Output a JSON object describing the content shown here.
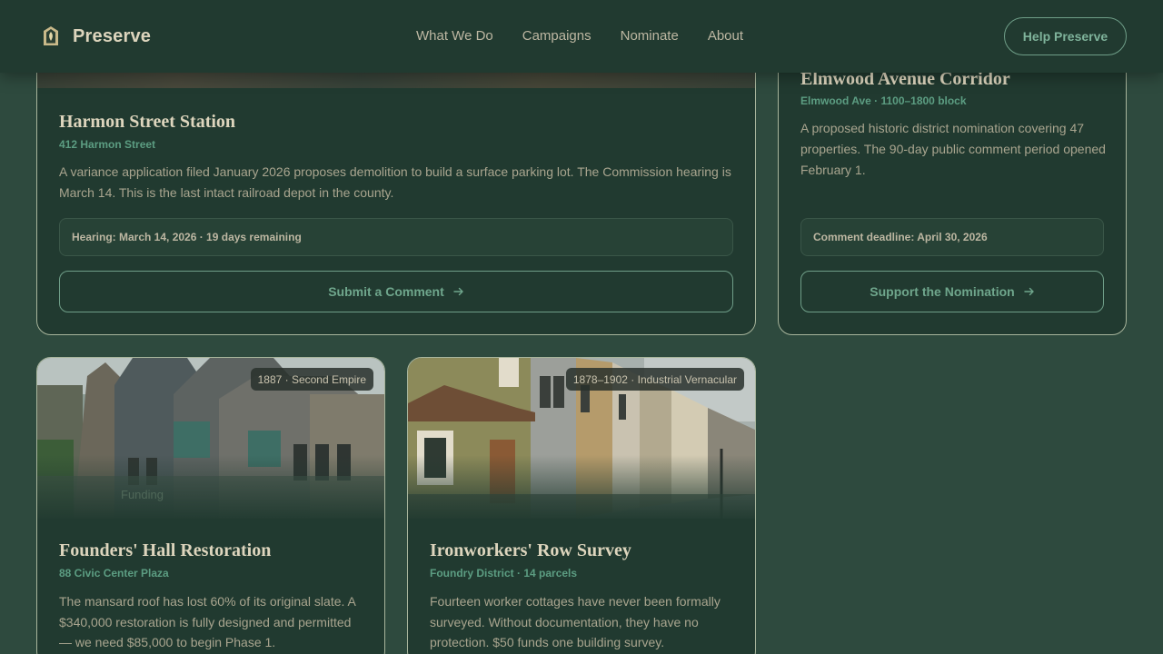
{
  "header": {
    "brand": "Preserve",
    "nav": [
      "What We Do",
      "Campaigns",
      "Nominate",
      "About"
    ],
    "cta_label": "Help Preserve"
  },
  "cards": {
    "harmon": {
      "title": "Harmon Street Station",
      "subtitle": "412 Harmon Street",
      "description": "A variance application filed January 2026 proposes demolition to build a surface parking lot. The Commission hearing is March 14. This is the last intact railroad depot in the county.",
      "info": "Hearing: March 14, 2026 · 19 days remaining",
      "button_label": "Submit a Comment"
    },
    "elmwood": {
      "title": "Elmwood Avenue Corridor",
      "subtitle": "Elmwood Ave · 1100–1800 block",
      "description": "A proposed historic district nomination covering 47 properties. The 90-day public comment period opened February 1.",
      "info": "Comment deadline: April 30, 2026",
      "button_label": "Support the Nomination"
    },
    "founders": {
      "badge": "1887 · Second Empire",
      "image_caption": "Funding",
      "title": "Founders' Hall Restoration",
      "subtitle": "88 Civic Center Plaza",
      "description": "The mansard roof has lost 60% of its original slate. A $340,000 restoration is fully designed and permitted — we need $85,000 to begin Phase 1."
    },
    "ironworkers": {
      "badge": "1878–1902 · Industrial Vernacular",
      "title": "Ironworkers' Row Survey",
      "subtitle": "Foundry District · 14 parcels",
      "description": "Fourteen worker cottages have never been formally surveyed. Without documentation, they have no protection. $50 funds one building survey."
    }
  },
  "colors": {
    "page_bg": "#2e4a3e",
    "card_bg": "#213a30",
    "accent": "#6fa68c",
    "heading": "#ddd5bd"
  }
}
